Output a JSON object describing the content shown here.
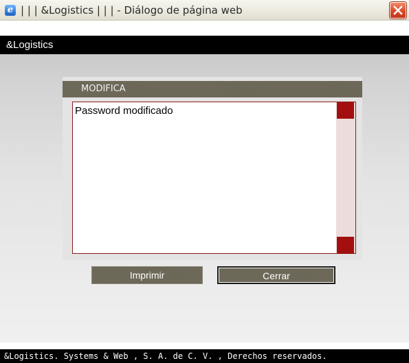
{
  "window": {
    "title": "| | | &Logistics | | | - Diálogo de página web",
    "icon": "internet-explorer-icon",
    "close_icon": "close-x-icon"
  },
  "app": {
    "header_title": "&Logistics"
  },
  "panel": {
    "title": "MODIFICA",
    "message": "Password modificado"
  },
  "buttons": {
    "print_label": "Imprimir",
    "close_label": "Cerrar"
  },
  "footer": {
    "text": "&Logistics. Systems & Web , S. A. de C. V. , Derechos reservados."
  },
  "colors": {
    "header_bg": "#000000",
    "panel_header_bg": "#6a6555",
    "accent_red": "#a30f0f",
    "body_bg": "#e4e4e4"
  }
}
